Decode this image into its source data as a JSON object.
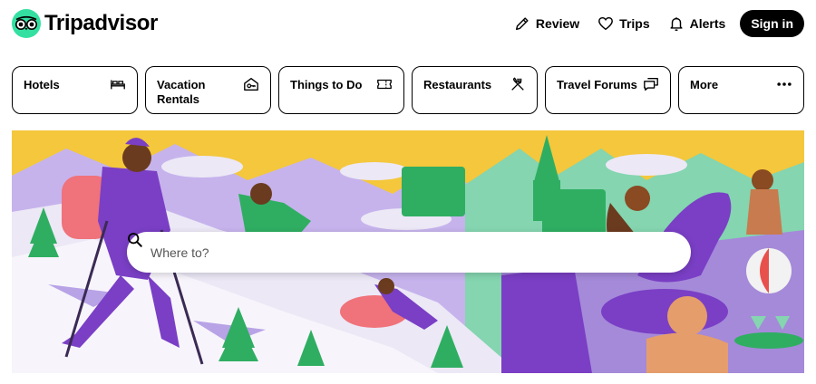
{
  "brand": {
    "name": "Tripadvisor",
    "accent": "#34e0a1"
  },
  "header": {
    "links": [
      {
        "label": "Review",
        "icon": "pencil-icon"
      },
      {
        "label": "Trips",
        "icon": "heart-icon"
      },
      {
        "label": "Alerts",
        "icon": "bell-icon"
      }
    ],
    "signin_label": "Sign in"
  },
  "categories": [
    {
      "label": "Hotels",
      "icon": "bed-icon"
    },
    {
      "label": "Vacation Rentals",
      "icon": "house-key-icon"
    },
    {
      "label": "Things to Do",
      "icon": "ticket-icon"
    },
    {
      "label": "Restaurants",
      "icon": "fork-knife-icon"
    },
    {
      "label": "Travel Forums",
      "icon": "chat-bubbles-icon"
    },
    {
      "label": "More",
      "icon": "more-dots-icon"
    }
  ],
  "search": {
    "placeholder": "Where to?",
    "icon": "search-icon"
  },
  "colors": {
    "hero_sky": "#f4c73c",
    "mountains": "#b8a3e6",
    "snow": "#ece8f6",
    "forest": "#2fae62",
    "purple": "#7a3fc5",
    "water": "#a58ad9"
  }
}
